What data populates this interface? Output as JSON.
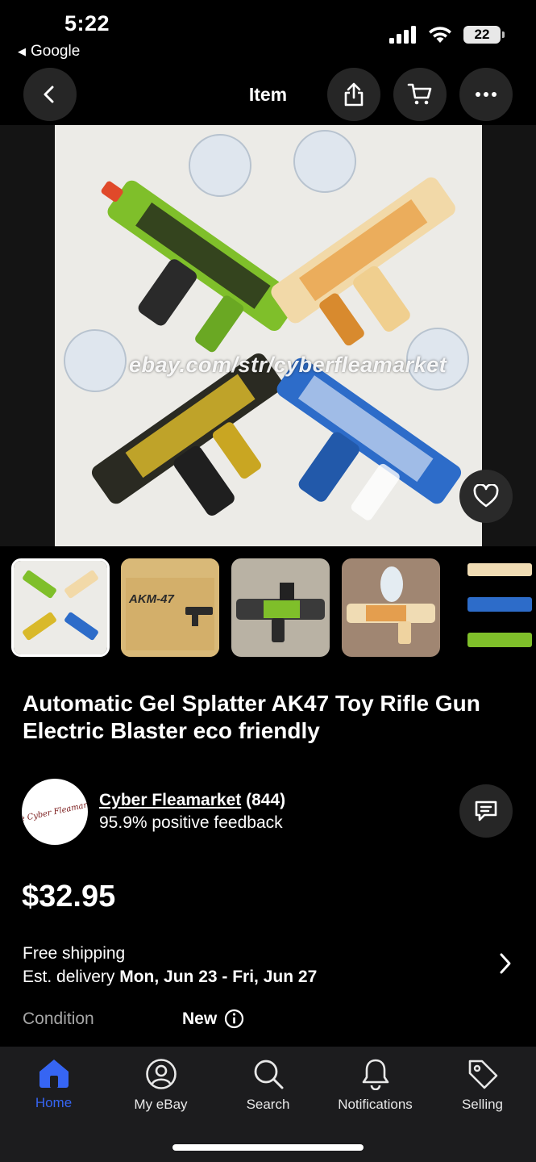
{
  "status_bar": {
    "time": "5:22",
    "back_app": "Google",
    "battery": "22"
  },
  "nav": {
    "title": "Item"
  },
  "hero": {
    "watermark": "ebay.com/str/cyberfleamarket"
  },
  "thumbnails": [
    {
      "label": "4 gel blasters"
    },
    {
      "label": "AKM-47"
    },
    {
      "label": "green blaster"
    },
    {
      "label": "orange blaster"
    },
    {
      "label": "3 blasters"
    }
  ],
  "thumbnail_box_text": "AKM-47",
  "product": {
    "title": "Automatic Gel Splatter AK47 Toy Rifle Gun Electric Blaster eco friendly",
    "price": "$32.95"
  },
  "seller": {
    "avatar_text": "The Cyber Fleamarket",
    "name": "Cyber Fleamarket",
    "count": "(844)",
    "feedback": "95.9% positive feedback"
  },
  "shipping": {
    "line1": "Free shipping",
    "line2_prefix": "Est. delivery ",
    "line2_dates": "Mon, Jun 23 - Fri, Jun 27"
  },
  "condition": {
    "label": "Condition",
    "value": "New"
  },
  "tabbar": {
    "items": [
      {
        "label": "Home",
        "icon": "home-icon",
        "active": true
      },
      {
        "label": "My eBay",
        "icon": "account-icon"
      },
      {
        "label": "Search",
        "icon": "search-icon"
      },
      {
        "label": "Notifications",
        "icon": "bell-icon"
      },
      {
        "label": "Selling",
        "icon": "tag-icon"
      }
    ]
  },
  "colors": {
    "background": "#000000",
    "surface": "#262626",
    "tabbar": "#1c1c1e",
    "accent": "#3665f3",
    "muted": "#a6a6a6"
  }
}
